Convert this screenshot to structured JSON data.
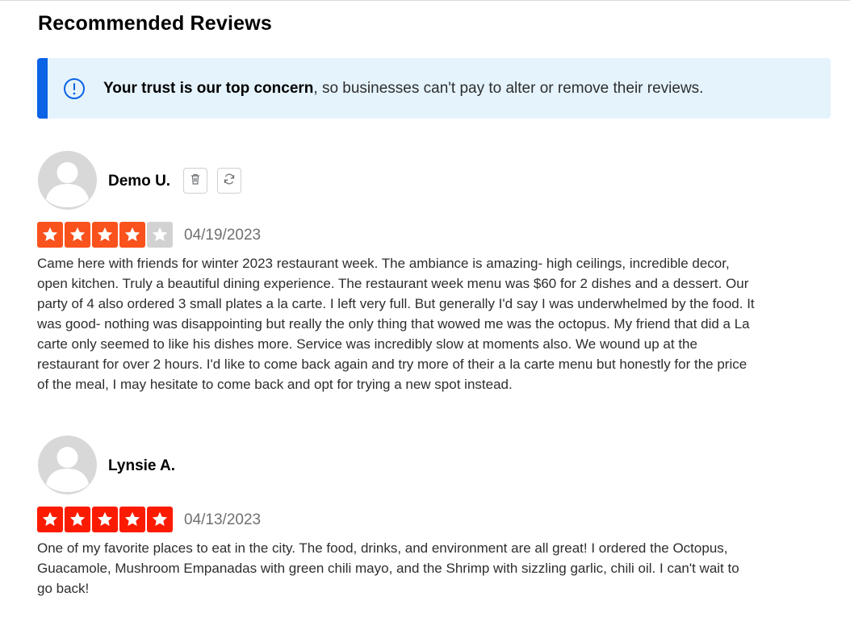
{
  "section": {
    "title": "Recommended Reviews"
  },
  "notice": {
    "icon": "info-circle-icon",
    "bold_text": "Your trust is our top concern",
    "text": ", so businesses can't pay to alter or remove their reviews.",
    "accent_color": "#0b63e5",
    "background_color": "#e5f3fc"
  },
  "reviews": [
    {
      "name": "Demo U.",
      "rating": 4,
      "rating_color": "#f9521c",
      "date": "04/19/2023",
      "actions": [
        "trash-icon",
        "refresh-icon"
      ],
      "text": "Came here with friends for winter 2023 restaurant week. The ambiance is amazing- high ceilings, incredible decor, open kitchen. Truly a beautiful dining experience. The restaurant week menu was $60 for 2 dishes and a dessert. Our party of 4 also ordered 3 small plates a la carte. I left very full. But generally I'd say I was underwhelmed by the food. It was good- nothing was disappointing but really the only thing that wowed me was the octopus. My friend that did a La carte only seemed to like his dishes more. Service was incredibly slow at moments also. We wound up at the restaurant for over 2 hours. I'd like to come back again and try more of their a la carte menu but honestly for the price of the meal, I may hesitate to come back and opt for trying a new spot instead."
    },
    {
      "name": "Lynsie A.",
      "rating": 5,
      "rating_color": "#fb1b00",
      "date": "04/13/2023",
      "actions": [],
      "text": "One of my favorite places to eat in the city. The food, drinks, and environment are all great! I ordered the Octopus, Guacamole, Mushroom Empanadas with green chili mayo, and the Shrimp with sizzling garlic, chili oil. I can't wait to go back!"
    }
  ],
  "colors": {
    "empty_star": "#d2d2d2"
  }
}
